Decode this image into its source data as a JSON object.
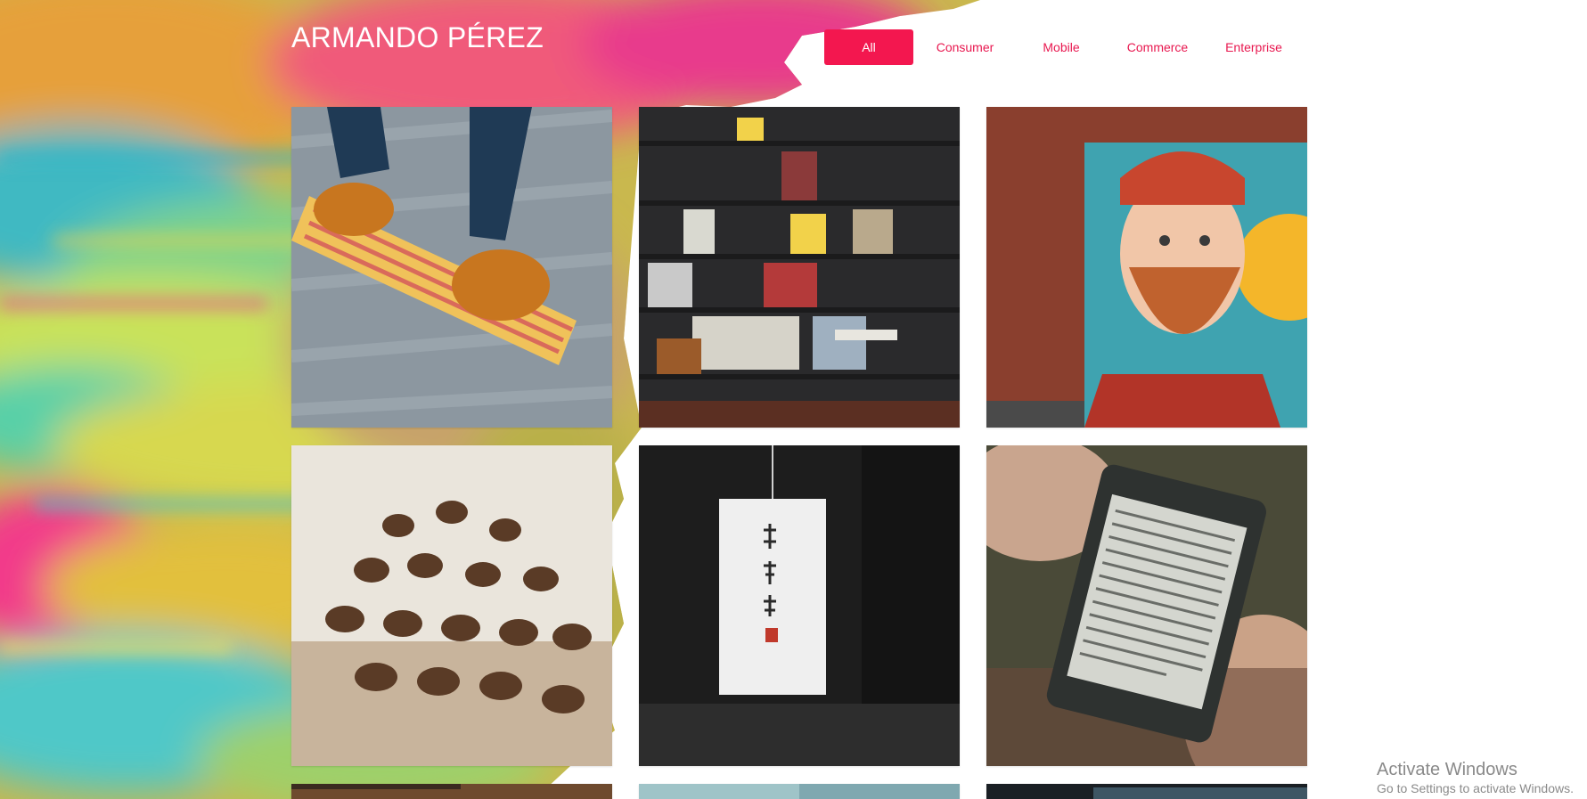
{
  "site": {
    "title": "ARMANDO PÉREZ"
  },
  "nav": {
    "items": [
      {
        "label": "All",
        "active": true
      },
      {
        "label": "Consumer",
        "active": false
      },
      {
        "label": "Mobile",
        "active": false
      },
      {
        "label": "Commerce",
        "active": false
      },
      {
        "label": "Enterprise",
        "active": false
      }
    ]
  },
  "gallery": {
    "items": [
      {
        "subject": "skateboard-shoes-photo"
      },
      {
        "subject": "bookshelf-photo"
      },
      {
        "subject": "bearded-man-mural-photo"
      },
      {
        "subject": "coffee-beans-photo"
      },
      {
        "subject": "paper-lantern-photo"
      },
      {
        "subject": "kindle-reader-photo"
      },
      {
        "subject": "partial-photo-1"
      },
      {
        "subject": "partial-photo-2"
      },
      {
        "subject": "partial-photo-3"
      }
    ]
  },
  "os_overlay": {
    "line1": "Activate Windows",
    "line2": "Go to Settings to activate Windows."
  },
  "colors": {
    "accent": "#f3174f",
    "accent_text": "#e8174f"
  }
}
